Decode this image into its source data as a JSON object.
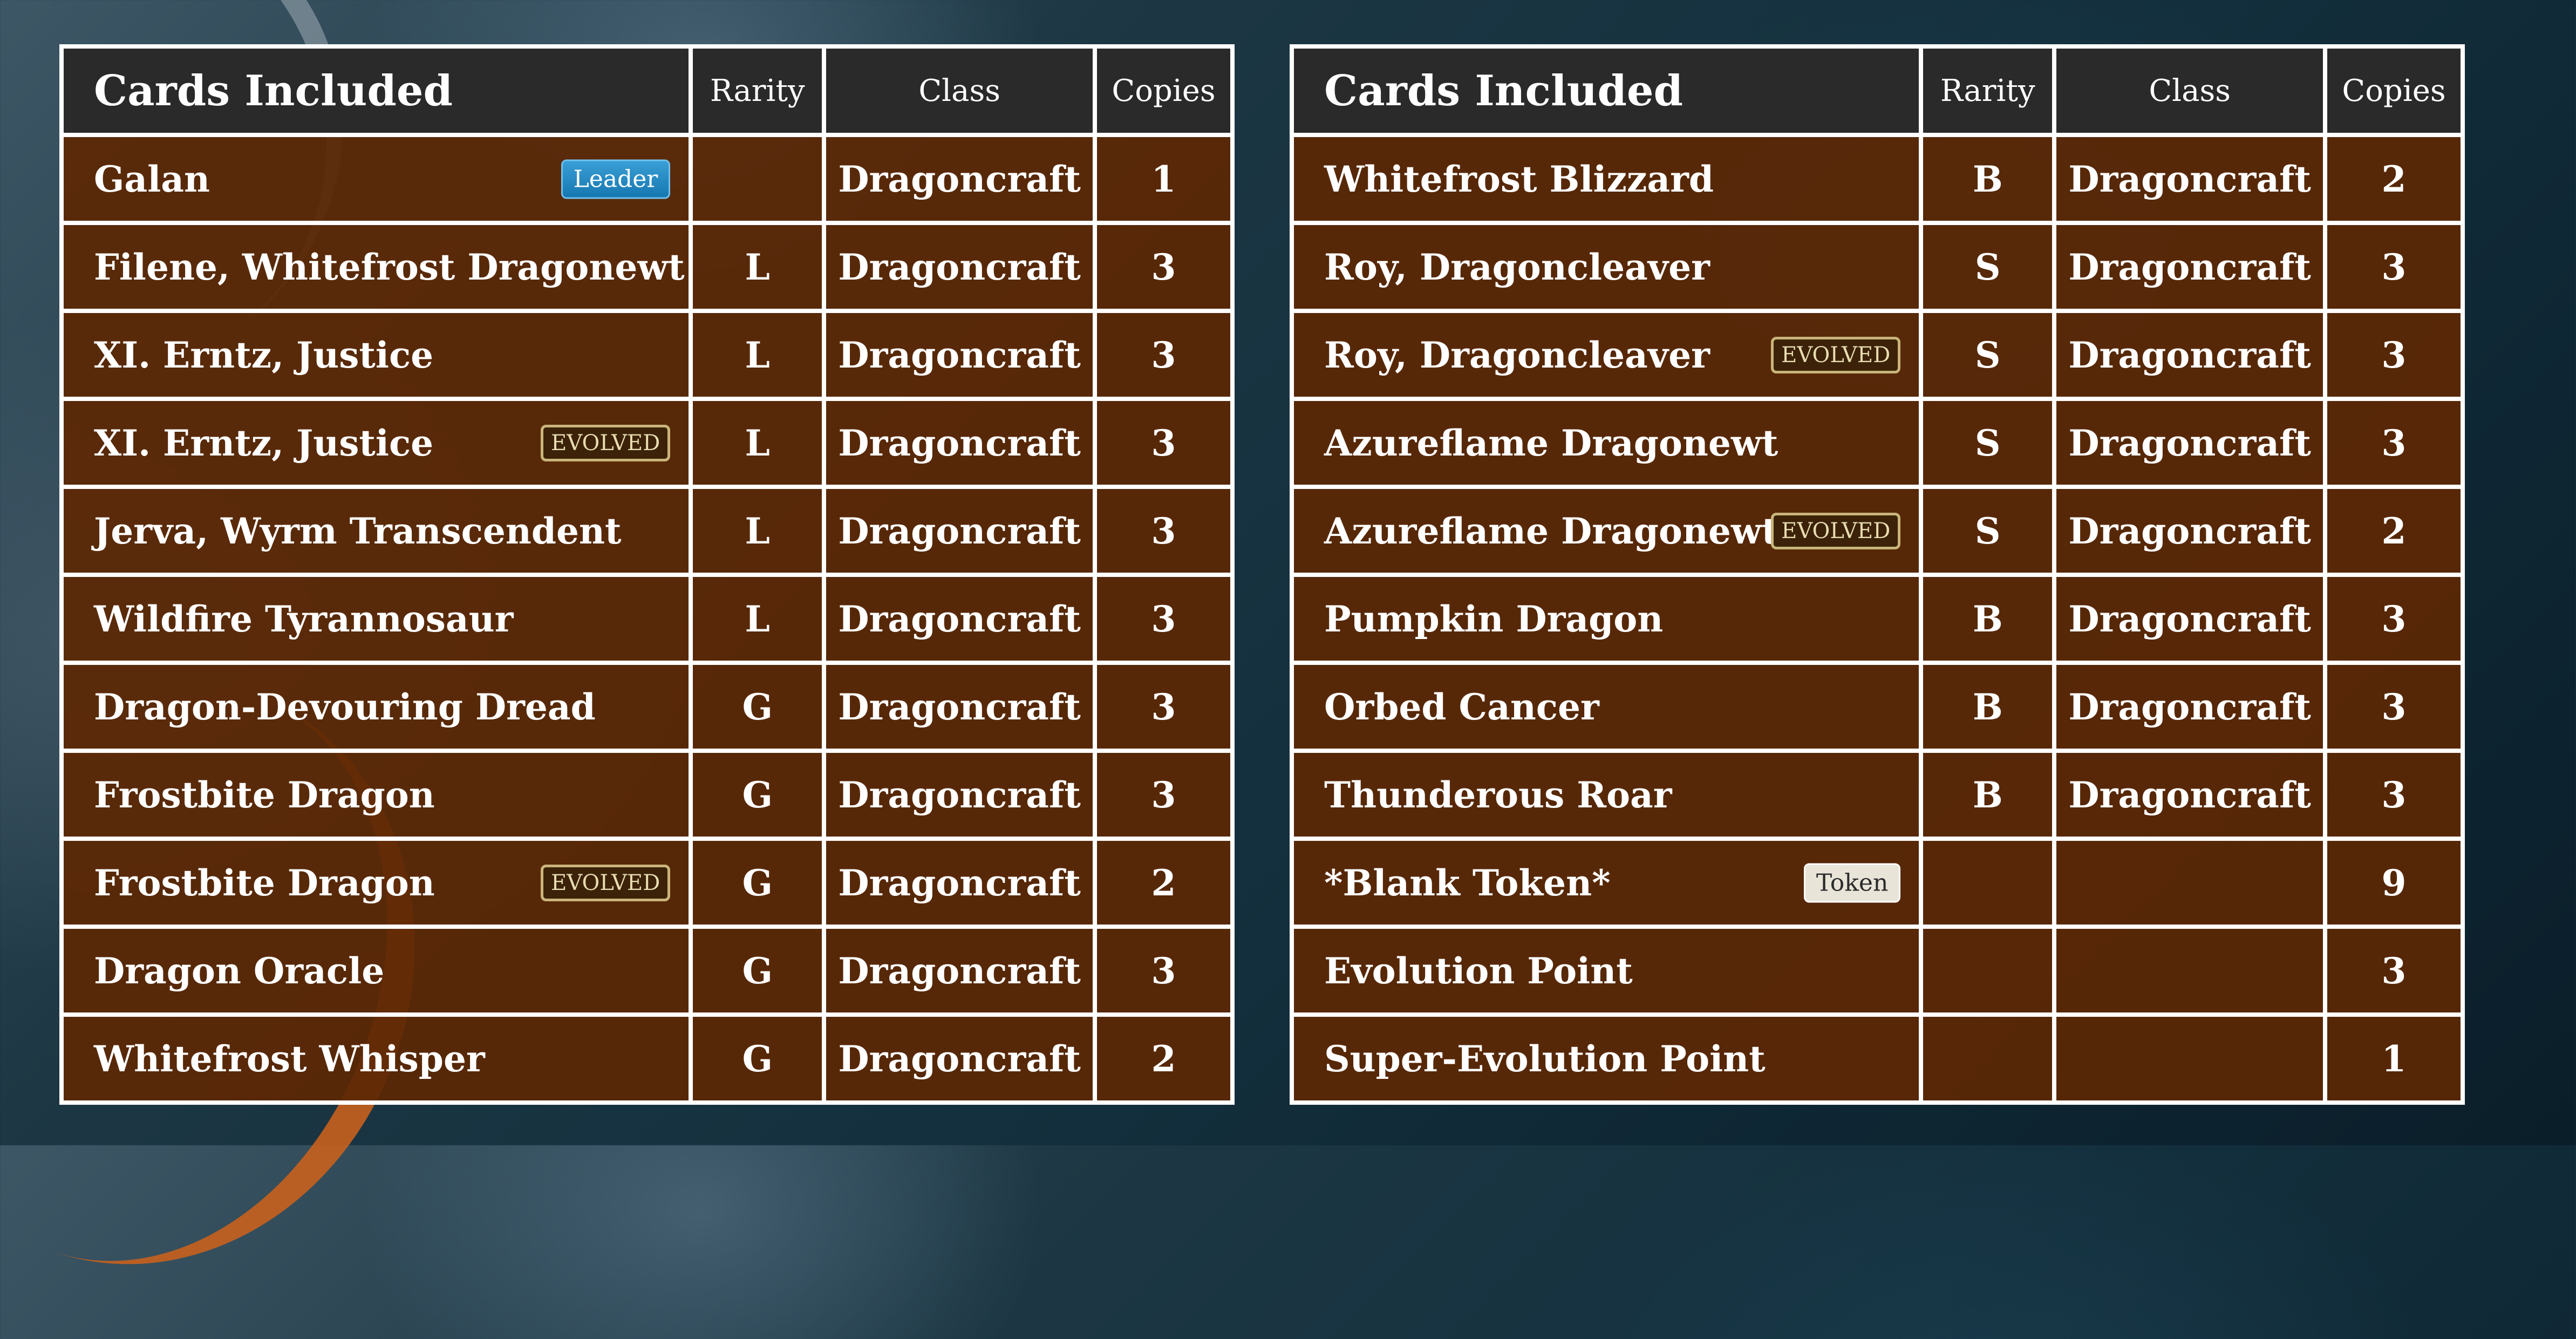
{
  "headers": {
    "name": "Cards Included",
    "rarity": "Rarity",
    "class": "Class",
    "copies": "Copies"
  },
  "tag_labels": {
    "leader": "Leader",
    "evolved": "EVOLVED",
    "token": "Token"
  },
  "colors": {
    "row_bg": "#5c2804",
    "header_bg": "#2a2a2a",
    "border": "#ffffff",
    "leader_tag": "#1f87c2"
  },
  "left_table": [
    {
      "name": "Galan",
      "tag": "leader",
      "rarity": "",
      "class": "Dragoncraft",
      "copies": "1"
    },
    {
      "name": "Filene, Whitefrost Dragonewt",
      "tag": "",
      "rarity": "L",
      "class": "Dragoncraft",
      "copies": "3"
    },
    {
      "name": "XI. Erntz, Justice",
      "tag": "",
      "rarity": "L",
      "class": "Dragoncraft",
      "copies": "3"
    },
    {
      "name": "XI. Erntz, Justice",
      "tag": "evolved",
      "rarity": "L",
      "class": "Dragoncraft",
      "copies": "3"
    },
    {
      "name": "Jerva, Wyrm Transcendent",
      "tag": "",
      "rarity": "L",
      "class": "Dragoncraft",
      "copies": "3"
    },
    {
      "name": "Wildfire Tyrannosaur",
      "tag": "",
      "rarity": "L",
      "class": "Dragoncraft",
      "copies": "3"
    },
    {
      "name": "Dragon-Devouring Dread",
      "tag": "",
      "rarity": "G",
      "class": "Dragoncraft",
      "copies": "3"
    },
    {
      "name": "Frostbite Dragon",
      "tag": "",
      "rarity": "G",
      "class": "Dragoncraft",
      "copies": "3"
    },
    {
      "name": "Frostbite Dragon",
      "tag": "evolved",
      "rarity": "G",
      "class": "Dragoncraft",
      "copies": "2"
    },
    {
      "name": "Dragon Oracle",
      "tag": "",
      "rarity": "G",
      "class": "Dragoncraft",
      "copies": "3"
    },
    {
      "name": "Whitefrost Whisper",
      "tag": "",
      "rarity": "G",
      "class": "Dragoncraft",
      "copies": "2"
    }
  ],
  "right_table": [
    {
      "name": "Whitefrost Blizzard",
      "tag": "",
      "rarity": "B",
      "class": "Dragoncraft",
      "copies": "2"
    },
    {
      "name": "Roy, Dragoncleaver",
      "tag": "",
      "rarity": "S",
      "class": "Dragoncraft",
      "copies": "3"
    },
    {
      "name": "Roy, Dragoncleaver",
      "tag": "evolved",
      "rarity": "S",
      "class": "Dragoncraft",
      "copies": "3"
    },
    {
      "name": "Azureflame Dragonewt",
      "tag": "",
      "rarity": "S",
      "class": "Dragoncraft",
      "copies": "3"
    },
    {
      "name": "Azureflame Dragonewt",
      "tag": "evolved",
      "rarity": "S",
      "class": "Dragoncraft",
      "copies": "2"
    },
    {
      "name": "Pumpkin Dragon",
      "tag": "",
      "rarity": "B",
      "class": "Dragoncraft",
      "copies": "3"
    },
    {
      "name": "Orbed Cancer",
      "tag": "",
      "rarity": "B",
      "class": "Dragoncraft",
      "copies": "3"
    },
    {
      "name": "Thunderous Roar",
      "tag": "",
      "rarity": "B",
      "class": "Dragoncraft",
      "copies": "3"
    },
    {
      "name": "*Blank Token*",
      "tag": "token",
      "rarity": "",
      "class": "",
      "copies": "9"
    },
    {
      "name": "Evolution Point",
      "tag": "",
      "rarity": "",
      "class": "",
      "copies": "3"
    },
    {
      "name": "Super-Evolution Point",
      "tag": "",
      "rarity": "",
      "class": "",
      "copies": "1"
    }
  ]
}
